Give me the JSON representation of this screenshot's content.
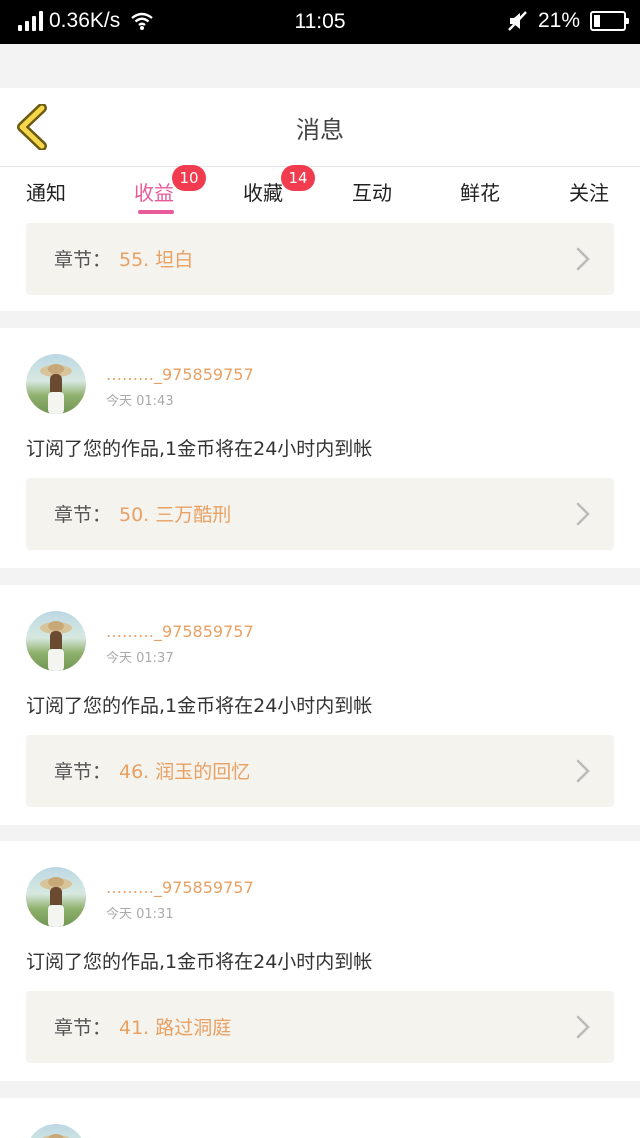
{
  "status_bar": {
    "network_speed": "0.36K/s",
    "time": "11:05",
    "battery": "21%",
    "battery_level": 0.21,
    "icons": [
      "signal-icon",
      "wifi-icon",
      "mute-icon",
      "battery-icon"
    ]
  },
  "header": {
    "title": "消息",
    "back_icon": "chevron-left-icon"
  },
  "tabs": [
    {
      "label": "通知",
      "badge": ""
    },
    {
      "label": "收益",
      "badge": "10",
      "active": true
    },
    {
      "label": "收藏",
      "badge": "14"
    },
    {
      "label": "互动",
      "badge": ""
    },
    {
      "label": "鲜花",
      "badge": ""
    },
    {
      "label": "关注",
      "badge": ""
    }
  ],
  "colors": {
    "accent": "#e85a9a",
    "badge": "#f03c4e",
    "highlight": "#e8a063"
  },
  "top_partial": {
    "chapter_label": "章节：",
    "chapter_title": "55. 坦白"
  },
  "messages": [
    {
      "username": "………_975859757",
      "time": "今天 01:43",
      "text": "订阅了您的作品,1金币将在24小时内到帐",
      "chapter_label": "章节：",
      "chapter_title": "50. 三万酷刑"
    },
    {
      "username": "………_975859757",
      "time": "今天 01:37",
      "text": "订阅了您的作品,1金币将在24小时内到帐",
      "chapter_label": "章节：",
      "chapter_title": "46. 润玉的回忆"
    },
    {
      "username": "………_975859757",
      "time": "今天 01:31",
      "text": "订阅了您的作品,1金币将在24小时内到帐",
      "chapter_label": "章节：",
      "chapter_title": "41. 路过洞庭"
    }
  ]
}
